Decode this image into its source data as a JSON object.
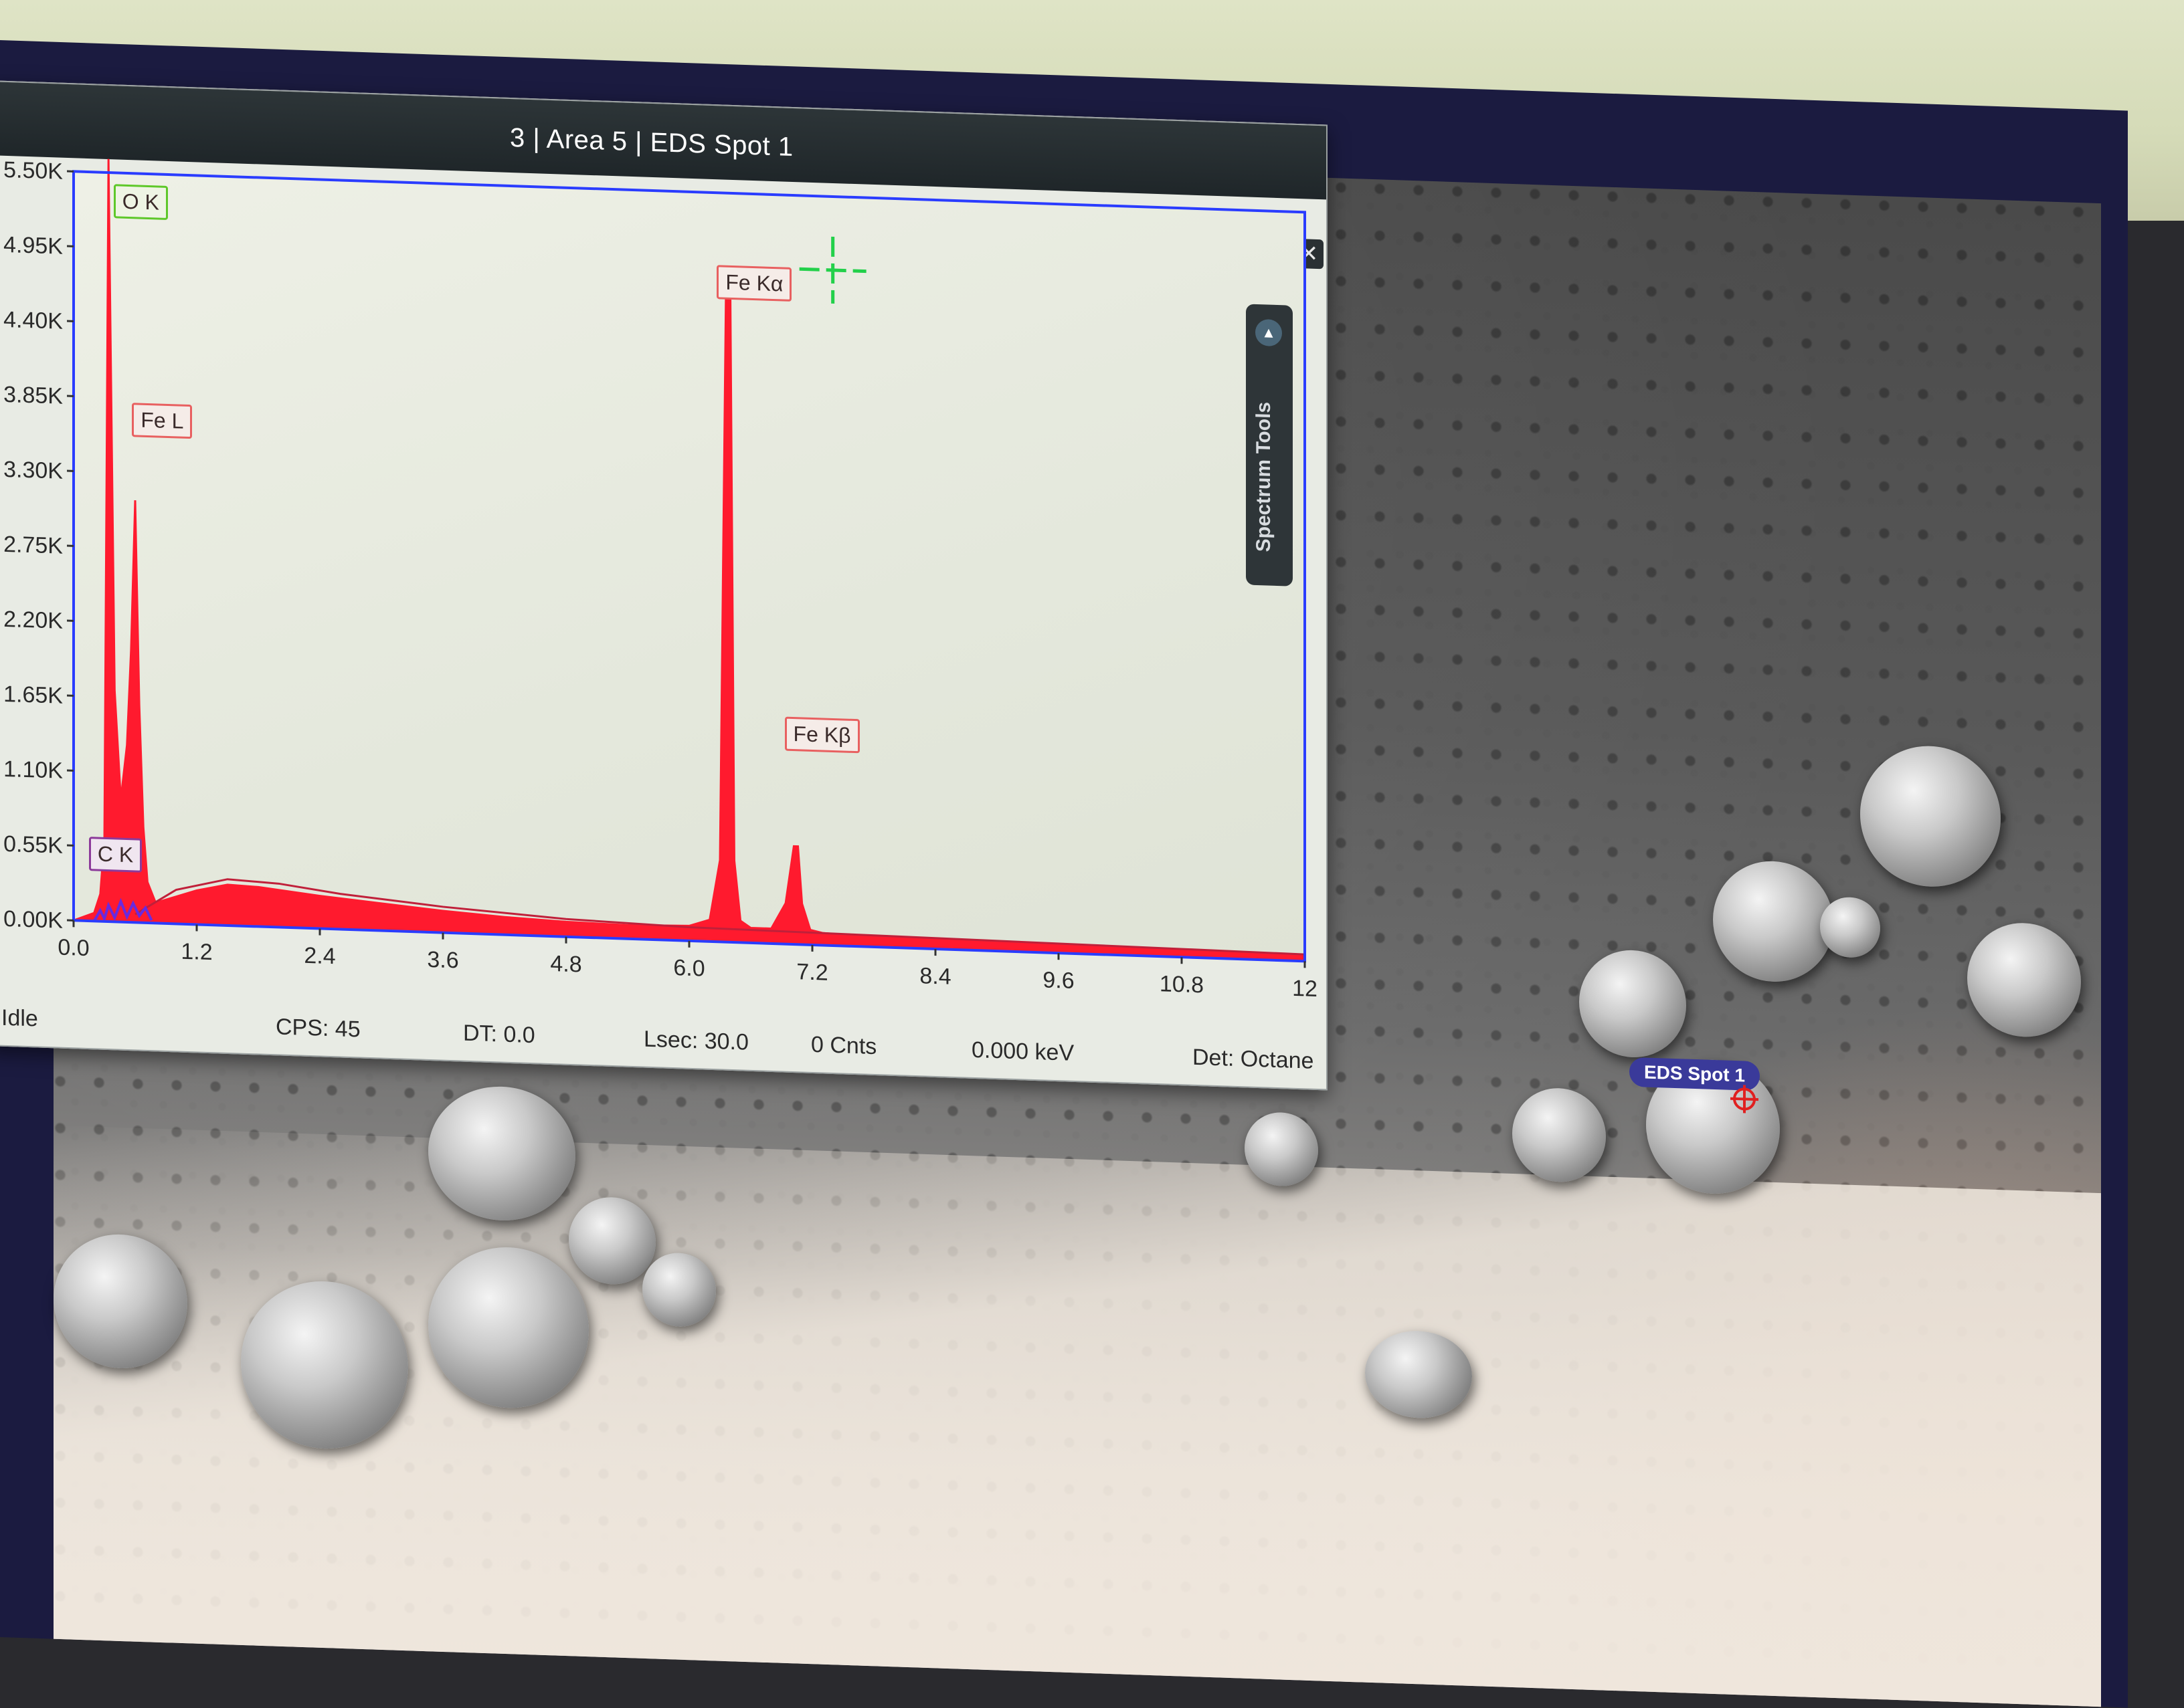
{
  "window": {
    "title": "3 | Area 5 | EDS Spot 1",
    "minimize_label": "–",
    "restore_label": "⛶",
    "close_label": "✕"
  },
  "spectrum_tools": {
    "label": "Spectrum Tools",
    "icon": "triangle-up-icon"
  },
  "status_bar": {
    "state": "Idle",
    "cps": "CPS: 45",
    "dt": "DT: 0.0",
    "lsec": "Lsec: 30.0",
    "counts": "0 Cnts",
    "energy": "0.000 keV",
    "detector": "Det: Octane"
  },
  "sem": {
    "spot_label": "EDS Spot 1"
  },
  "colors": {
    "spectrum_fill": "#ff1a2e",
    "plot_border": "#2a3cff",
    "cursor": "#22d04a",
    "background_fit": "#c0203a",
    "c_peak_overlay": "#6a2adf"
  },
  "chart_data": {
    "type": "area",
    "title": "",
    "xlabel": "",
    "ylabel": "",
    "xlim": [
      0.0,
      12.0
    ],
    "ylim": [
      0,
      5500
    ],
    "x_ticks": [
      "0.0",
      "1.2",
      "2.4",
      "3.6",
      "4.8",
      "6.0",
      "7.2",
      "8.4",
      "9.6",
      "10.8",
      "12"
    ],
    "y_ticks": [
      "0.00K",
      "0.55K",
      "1.10K",
      "1.65K",
      "2.20K",
      "2.75K",
      "3.30K",
      "3.85K",
      "4.40K",
      "4.95K",
      "5.50K"
    ],
    "x_tick_values": [
      0,
      1.2,
      2.4,
      3.6,
      4.8,
      6.0,
      7.2,
      8.4,
      9.6,
      10.8,
      12
    ],
    "y_tick_values": [
      0,
      550,
      1100,
      1650,
      2200,
      2750,
      3300,
      3850,
      4400,
      4950,
      5500
    ],
    "series": [
      {
        "x": [
          0.0,
          0.2,
          0.26,
          0.3,
          0.34,
          0.4,
          0.46,
          0.52,
          0.56,
          0.6,
          0.64,
          0.68,
          0.72,
          0.8,
          1.0,
          1.2,
          1.5,
          1.8,
          2.4,
          3.0,
          3.6,
          4.2,
          4.8,
          5.4,
          6.0,
          6.2,
          6.3,
          6.36,
          6.4,
          6.44,
          6.5,
          6.6,
          6.8,
          6.94,
          7.02,
          7.06,
          7.1,
          7.18,
          7.3,
          7.6,
          8.4,
          9.6,
          10.8,
          12.0
        ],
        "y": [
          0,
          60,
          200,
          600,
          5600,
          1700,
          900,
          1300,
          2000,
          3100,
          1600,
          700,
          300,
          150,
          200,
          250,
          300,
          290,
          240,
          200,
          160,
          130,
          110,
          100,
          110,
          160,
          600,
          4900,
          4900,
          600,
          160,
          110,
          110,
          300,
          720,
          720,
          300,
          110,
          90,
          80,
          70,
          60,
          50,
          40
        ]
      }
    ],
    "peak_labels": [
      {
        "text": "O  K",
        "x": 0.52
      },
      {
        "text": "Fe L",
        "x": 0.7
      },
      {
        "text": "C  K",
        "x": 0.28
      },
      {
        "text": "Fe Kα",
        "x": 6.4
      },
      {
        "text": "Fe Kβ",
        "x": 7.06
      }
    ]
  }
}
